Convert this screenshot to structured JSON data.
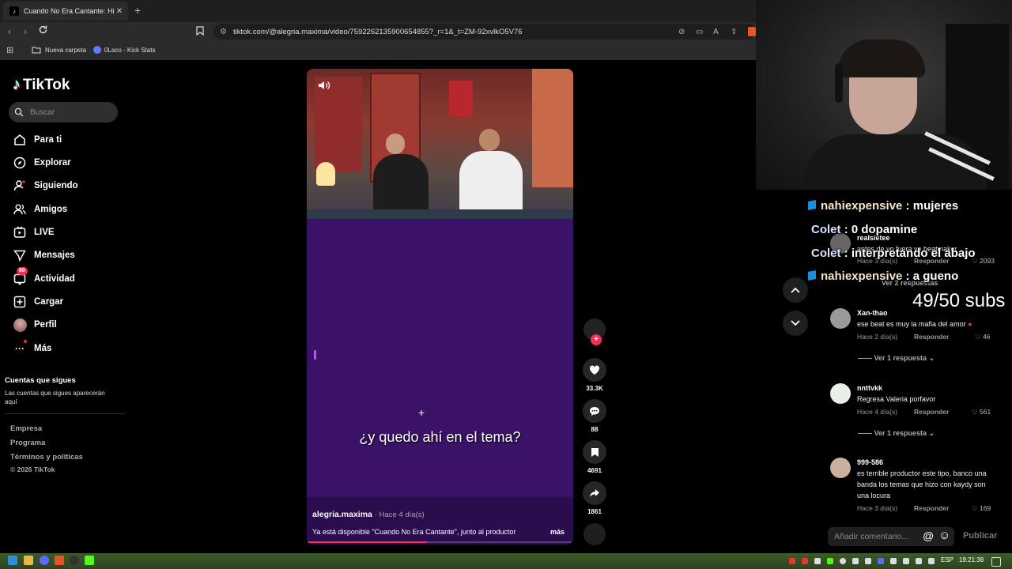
{
  "browser": {
    "tab_title": "Cuando No Era Cantante: His",
    "tab_close": "✕",
    "new_tab": "+",
    "url": "tiktok.com/@alegria.maxima/video/7592262135900654855?_r=1&_t=ZM-92xvlkO5V76",
    "bookmarks": [
      {
        "label": "Nueva carpeta"
      },
      {
        "label": "0Laco - Kick Stats"
      }
    ]
  },
  "sidebar": {
    "logo": "TikTok",
    "search_placeholder": "Buscar",
    "nav": [
      {
        "label": "Para ti",
        "icon": "home-icon"
      },
      {
        "label": "Explorar",
        "icon": "compass-icon"
      },
      {
        "label": "Siguiendo",
        "icon": "following-icon"
      },
      {
        "label": "Amigos",
        "icon": "friends-icon"
      },
      {
        "label": "LIVE",
        "icon": "live-icon"
      },
      {
        "label": "Mensajes",
        "icon": "messages-icon"
      },
      {
        "label": "Actividad",
        "icon": "activity-icon",
        "badge": "60"
      },
      {
        "label": "Cargar",
        "icon": "upload-icon"
      },
      {
        "label": "Perfil",
        "icon": "avatar"
      },
      {
        "label": "Más",
        "icon": "more-icon"
      }
    ],
    "followed_heading": "Cuentas que sigues",
    "followed_text": "Las cuentas que sigues aparecerán aquí",
    "footer": [
      "Empresa",
      "Programa",
      "Términos y políticas",
      "© 2026 TikTok"
    ]
  },
  "video": {
    "subtitle": "¿y quedo ahí en el tema?",
    "author": "alegria.maxima",
    "posted": "· Hace 4 día(s)",
    "description": "Ya está disponible \"Cuando No Era Cantante\", junto al productor",
    "more": "más",
    "progress": 0.45
  },
  "actions": {
    "likes": "33.3K",
    "comments": "88",
    "saves": "4691",
    "shares": "1861"
  },
  "comments": {
    "items": [
      {
        "user": "realsietee",
        "text": "antes de yo fuera yo beatmaker",
        "time": "Hace 3 día(s)",
        "reply": "Responder",
        "likes": "2093"
      },
      {
        "user": "Xan-thao",
        "text": "ese beat es muy la mafia del amor",
        "time": "Hace 2 día(s)",
        "reply": "Responder",
        "likes": "46",
        "more": "Ver 1 respuesta"
      },
      {
        "user": "nnttvkk",
        "text": "Regresa Valeria porfavor",
        "time": "Hace 4 día(s)",
        "reply": "Responder",
        "likes": "561",
        "more": "Ver 1 respuesta"
      },
      {
        "user": "999-586",
        "text": "es terrible productor este tipo, banco una banda los temas que hizo con kaydy son una locura",
        "time": "Hace 3 día(s)",
        "reply": "Responder",
        "likes": "169"
      }
    ],
    "view_replies_top": "Ver 2 respuestas",
    "input_placeholder": "Añadir comentario...",
    "publish": "Publicar"
  },
  "overlay": {
    "chat": [
      {
        "name": "nahiexpensive",
        "sep": " : ",
        "msg": "mujeres",
        "badge": true
      },
      {
        "name": "Colet",
        "sep": " : ",
        "msg": "0 dopamine",
        "badge": false
      },
      {
        "name": "Colet",
        "sep": " : ",
        "msg": "interpretando el abajo",
        "badge": false
      },
      {
        "name": "nahiexpensive",
        "sep": " : ",
        "msg": "a gueno",
        "badge": true
      }
    ],
    "subs": "49/50 subs"
  },
  "taskbar": {
    "lang": "ESP",
    "time": "19:21:38"
  },
  "colors": {
    "accent": "#fe2c55",
    "video_bg": "#3f1670",
    "taskbar": "#2c4520"
  }
}
